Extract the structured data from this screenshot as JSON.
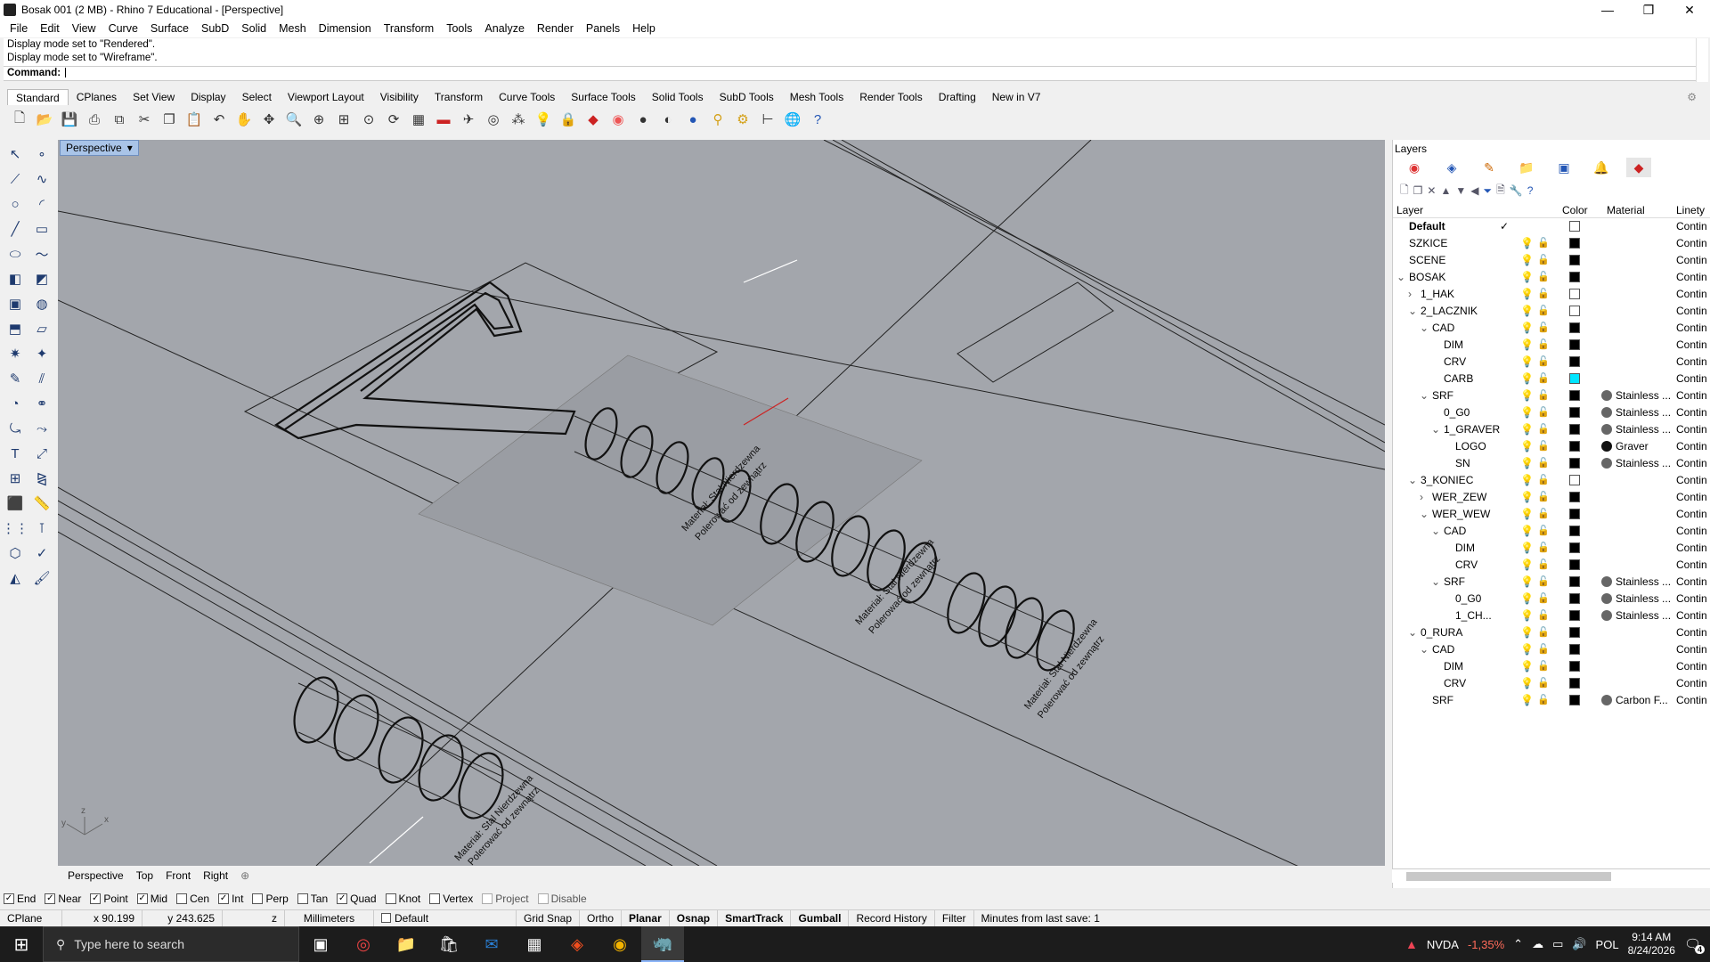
{
  "title": "Bosak 001 (2 MB) - Rhino 7 Educational - [Perspective]",
  "window_controls": [
    "—",
    "❐",
    "✕"
  ],
  "menu": [
    "File",
    "Edit",
    "View",
    "Curve",
    "Surface",
    "SubD",
    "Solid",
    "Mesh",
    "Dimension",
    "Transform",
    "Tools",
    "Analyze",
    "Render",
    "Panels",
    "Help"
  ],
  "history": [
    "Display mode set to \"Rendered\".",
    "Display mode set to \"Wireframe\"."
  ],
  "command_prompt": "Command:",
  "toolbar_tabs": [
    "Standard",
    "CPlanes",
    "Set View",
    "Display",
    "Select",
    "Viewport Layout",
    "Visibility",
    "Transform",
    "Curve Tools",
    "Surface Tools",
    "Solid Tools",
    "SubD Tools",
    "Mesh Tools",
    "Render Tools",
    "Drafting",
    "New in V7"
  ],
  "viewport": {
    "name": "Perspective",
    "annotations": [
      "Materiał: Stal Nierdzewna",
      "Polerować od zewnątrz",
      "Materiał: Stal Nierdzewna",
      "Polerować od zewnątrz",
      "Materiał: Stal Nierdzewna",
      "Polerować od zewnątrz",
      "Materiał: Stal Nierdzewna",
      "Polerować od zewnątrz"
    ],
    "axis": {
      "x": "x",
      "y": "y",
      "z": "z"
    }
  },
  "view_tabs": [
    "Perspective",
    "Top",
    "Front",
    "Right"
  ],
  "osnaps": [
    {
      "label": "End",
      "checked": true
    },
    {
      "label": "Near",
      "checked": true
    },
    {
      "label": "Point",
      "checked": true
    },
    {
      "label": "Mid",
      "checked": true
    },
    {
      "label": "Cen",
      "checked": false
    },
    {
      "label": "Int",
      "checked": true
    },
    {
      "label": "Perp",
      "checked": false
    },
    {
      "label": "Tan",
      "checked": false
    },
    {
      "label": "Quad",
      "checked": true
    },
    {
      "label": "Knot",
      "checked": false
    },
    {
      "label": "Vertex",
      "checked": false
    },
    {
      "label": "Project",
      "checked": false
    },
    {
      "label": "Disable",
      "checked": false
    }
  ],
  "status": {
    "cplane": "CPlane",
    "x": "x 90.199",
    "y": "y 243.625",
    "z": "z",
    "units": "Millimeters",
    "layer": "Default",
    "toggles": [
      "Grid Snap",
      "Ortho",
      "Planar",
      "Osnap",
      "SmartTrack",
      "Gumball",
      "Record History",
      "Filter"
    ],
    "save_info": "Minutes from last save: 1"
  },
  "layers_panel": {
    "title": "Layers",
    "columns": [
      "Layer",
      "Color",
      "Material",
      "Linety"
    ],
    "rows": [
      {
        "name": "Default",
        "indent": 0,
        "expander": "",
        "current": true,
        "color": "#ffffff",
        "material": "",
        "linetype": "Contin"
      },
      {
        "name": "SZKICE",
        "indent": 0,
        "expander": "",
        "color": "#000000",
        "material": "",
        "linetype": "Contin"
      },
      {
        "name": "SCENE",
        "indent": 0,
        "expander": "",
        "color": "#000000",
        "material": "",
        "linetype": "Contin"
      },
      {
        "name": "BOSAK",
        "indent": 0,
        "expander": "v",
        "color": "#000000",
        "material": "",
        "linetype": "Contin"
      },
      {
        "name": "1_HAK",
        "indent": 1,
        "expander": ">",
        "color": "#ffffff",
        "material": "",
        "linetype": "Contin"
      },
      {
        "name": "2_LACZNIK",
        "indent": 1,
        "expander": "v",
        "color": "#ffffff",
        "material": "",
        "linetype": "Contin"
      },
      {
        "name": "CAD",
        "indent": 2,
        "expander": "v",
        "color": "#000000",
        "material": "",
        "linetype": "Contin"
      },
      {
        "name": "DIM",
        "indent": 3,
        "expander": "",
        "color": "#000000",
        "material": "",
        "linetype": "Contin"
      },
      {
        "name": "CRV",
        "indent": 3,
        "expander": "",
        "color": "#000000",
        "material": "",
        "linetype": "Contin"
      },
      {
        "name": "CARB",
        "indent": 3,
        "expander": "",
        "color": "#00e5ff",
        "material": "",
        "linetype": "Contin"
      },
      {
        "name": "SRF",
        "indent": 2,
        "expander": "v",
        "color": "#000000",
        "material": "Stainless ...",
        "linetype": "Contin"
      },
      {
        "name": "0_G0",
        "indent": 3,
        "expander": "",
        "color": "#000000",
        "material": "Stainless ...",
        "linetype": "Contin"
      },
      {
        "name": "1_GRAVER",
        "indent": 3,
        "expander": "v",
        "color": "#000000",
        "material": "Stainless ...",
        "linetype": "Contin"
      },
      {
        "name": "LOGO",
        "indent": 4,
        "expander": "",
        "color": "#000000",
        "material": "Graver",
        "linetype": "Contin"
      },
      {
        "name": "SN",
        "indent": 4,
        "expander": "",
        "color": "#000000",
        "material": "Stainless ...",
        "linetype": "Contin"
      },
      {
        "name": "3_KONIEC",
        "indent": 1,
        "expander": "v",
        "color": "#ffffff",
        "material": "",
        "linetype": "Contin"
      },
      {
        "name": "WER_ZEW",
        "indent": 2,
        "expander": ">",
        "color": "#000000",
        "material": "",
        "linetype": "Contin"
      },
      {
        "name": "WER_WEW",
        "indent": 2,
        "expander": "v",
        "color": "#000000",
        "material": "",
        "linetype": "Contin"
      },
      {
        "name": "CAD",
        "indent": 3,
        "expander": "v",
        "color": "#000000",
        "material": "",
        "linetype": "Contin"
      },
      {
        "name": "DIM",
        "indent": 4,
        "expander": "",
        "color": "#000000",
        "material": "",
        "linetype": "Contin"
      },
      {
        "name": "CRV",
        "indent": 4,
        "expander": "",
        "color": "#000000",
        "material": "",
        "linetype": "Contin"
      },
      {
        "name": "SRF",
        "indent": 3,
        "expander": "v",
        "color": "#000000",
        "material": "Stainless ...",
        "linetype": "Contin"
      },
      {
        "name": "0_G0",
        "indent": 4,
        "expander": "",
        "color": "#000000",
        "material": "Stainless ...",
        "linetype": "Contin"
      },
      {
        "name": "1_CH...",
        "indent": 4,
        "expander": "",
        "color": "#000000",
        "material": "Stainless ...",
        "linetype": "Contin"
      },
      {
        "name": "0_RURA",
        "indent": 1,
        "expander": "v",
        "color": "#000000",
        "material": "",
        "linetype": "Contin"
      },
      {
        "name": "CAD",
        "indent": 2,
        "expander": "v",
        "color": "#000000",
        "material": "",
        "linetype": "Contin"
      },
      {
        "name": "DIM",
        "indent": 3,
        "expander": "",
        "color": "#000000",
        "material": "",
        "linetype": "Contin"
      },
      {
        "name": "CRV",
        "indent": 3,
        "expander": "",
        "color": "#000000",
        "material": "",
        "linetype": "Contin"
      },
      {
        "name": "SRF",
        "indent": 2,
        "expander": "",
        "color": "#000000",
        "material": "Carbon F...",
        "linetype": "Contin"
      }
    ]
  },
  "taskbar": {
    "search_placeholder": "Type here to search",
    "stock_name": "NVDA",
    "stock_change": "-1,35%",
    "language": "POL",
    "time": "9:14 AM",
    "date": "8/24/2026",
    "notification_count": "4"
  },
  "colors": {
    "viewport_bg": "#a3a6ac",
    "accent": "#a9c4e8",
    "stock_down": "#ff6b5a"
  }
}
